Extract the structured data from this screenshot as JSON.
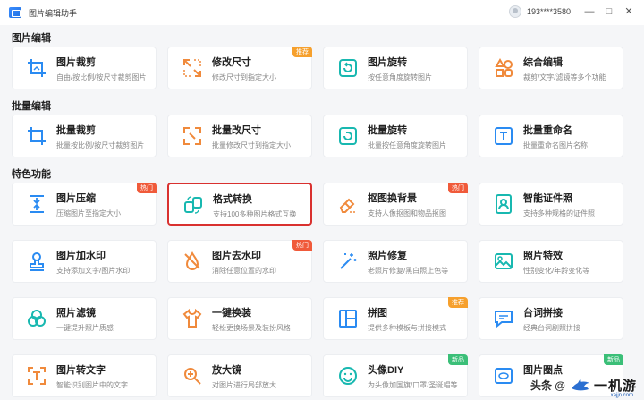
{
  "app": {
    "title": "图片编辑助手"
  },
  "user": {
    "id": "193****3580"
  },
  "window": {
    "minimize": "—",
    "maximize": "□",
    "close": "✕"
  },
  "sections": [
    {
      "title": "图片编辑"
    },
    {
      "title": "批量编辑"
    },
    {
      "title": "特色功能"
    }
  ],
  "cards": {
    "crop": {
      "title": "图片裁剪",
      "desc": "自由/按比例/按尺寸裁剪图片"
    },
    "resize": {
      "title": "修改尺寸",
      "desc": "修改尺寸到指定大小",
      "badge": "推荐"
    },
    "rotate": {
      "title": "图片旋转",
      "desc": "按任意角度旋转图片"
    },
    "edit": {
      "title": "综合编辑",
      "desc": "裁剪/文字/滤镜等多个功能"
    },
    "batch_crop": {
      "title": "批量裁剪",
      "desc": "批量按比例/按尺寸裁剪图片"
    },
    "batch_resize": {
      "title": "批量改尺寸",
      "desc": "批量修改尺寸到指定大小"
    },
    "batch_rotate": {
      "title": "批量旋转",
      "desc": "批量按任意角度旋转图片"
    },
    "batch_rename": {
      "title": "批量重命名",
      "desc": "批量重命名图片名称"
    },
    "compress": {
      "title": "图片压缩",
      "desc": "压缩图片至指定大小",
      "badge": "热门"
    },
    "convert": {
      "title": "格式转换",
      "desc": "支持100多种图片格式互换"
    },
    "cutout": {
      "title": "抠图换背景",
      "desc": "支持人像抠图和物品抠图",
      "badge": "热门"
    },
    "id_photo": {
      "title": "智能证件照",
      "desc": "支持多种规格的证件照"
    },
    "add_watermark": {
      "title": "图片加水印",
      "desc": "支持添加文字/图片水印"
    },
    "remove_watermark": {
      "title": "图片去水印",
      "desc": "消除任意位置的水印",
      "badge": "热门"
    },
    "restore": {
      "title": "照片修复",
      "desc": "老照片修复/黑白照上色等"
    },
    "effects": {
      "title": "照片特效",
      "desc": "性别变化/年龄变化等"
    },
    "filter": {
      "title": "照片滤镜",
      "desc": "一键提升照片质感"
    },
    "outfit": {
      "title": "一键换装",
      "desc": "轻松更换场景及装扮风格"
    },
    "collage": {
      "title": "拼图",
      "desc": "提供多种模板与拼接模式",
      "badge": "推荐"
    },
    "lines": {
      "title": "台词拼接",
      "desc": "经典台词剧照拼接"
    },
    "ocr": {
      "title": "图片转文字",
      "desc": "智能识别图片中的文字"
    },
    "magnify": {
      "title": "放大镜",
      "desc": "对图片进行局部放大"
    },
    "avatar": {
      "title": "头像DIY",
      "desc": "为头像加国旗/口罩/圣诞帽等",
      "badge": "新品"
    },
    "circle": {
      "title": "图片圈点",
      "desc": "",
      "badge": "新品"
    }
  },
  "watermark": {
    "text": "头条 @",
    "brand": "一机游",
    "site": "xajjn.com"
  },
  "colors": {
    "accent": "#2a8bf2",
    "teal": "#18b8b0",
    "orange": "#f6a02d",
    "red": "#f05a3a",
    "green": "#3bbf78",
    "highlight": "#d9312f"
  }
}
